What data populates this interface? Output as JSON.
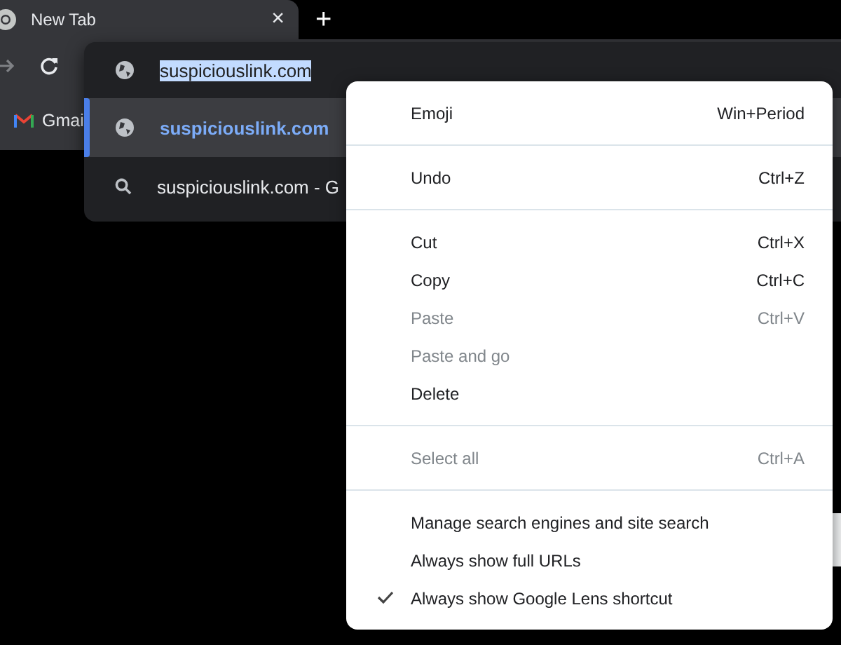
{
  "tab": {
    "title": "New Tab",
    "close": "×",
    "new_tab": "+"
  },
  "bookmarks": [
    {
      "label": "Gmai"
    }
  ],
  "omnibox": {
    "value": "suspiciouslink.com",
    "value_selected": true,
    "suggestions": [
      {
        "kind": "url",
        "text": "suspiciouslink.com",
        "selected": true
      },
      {
        "kind": "search",
        "text": "suspiciouslink.com - G",
        "selected": false
      }
    ]
  },
  "menu": {
    "sections": [
      {
        "items": [
          {
            "label": "Emoji",
            "shortcut": "Win+Period",
            "disabled": false,
            "checked": false
          }
        ]
      },
      {
        "items": [
          {
            "label": "Undo",
            "shortcut": "Ctrl+Z",
            "disabled": false,
            "checked": false
          }
        ]
      },
      {
        "items": [
          {
            "label": "Cut",
            "shortcut": "Ctrl+X",
            "disabled": false,
            "checked": false
          },
          {
            "label": "Copy",
            "shortcut": "Ctrl+C",
            "disabled": false,
            "checked": false
          },
          {
            "label": "Paste",
            "shortcut": "Ctrl+V",
            "disabled": true,
            "checked": false
          },
          {
            "label": "Paste and go",
            "disabled": true,
            "checked": false
          },
          {
            "label": "Delete",
            "disabled": false,
            "checked": false
          }
        ]
      },
      {
        "items": [
          {
            "label": "Select all",
            "shortcut": "Ctrl+A",
            "disabled": true,
            "checked": false
          }
        ]
      },
      {
        "items": [
          {
            "label": "Manage search engines and site search",
            "disabled": false,
            "checked": false
          },
          {
            "label": "Always show full URLs",
            "disabled": false,
            "checked": false
          },
          {
            "label": "Always show Google Lens shortcut",
            "disabled": false,
            "checked": true
          }
        ]
      }
    ]
  }
}
